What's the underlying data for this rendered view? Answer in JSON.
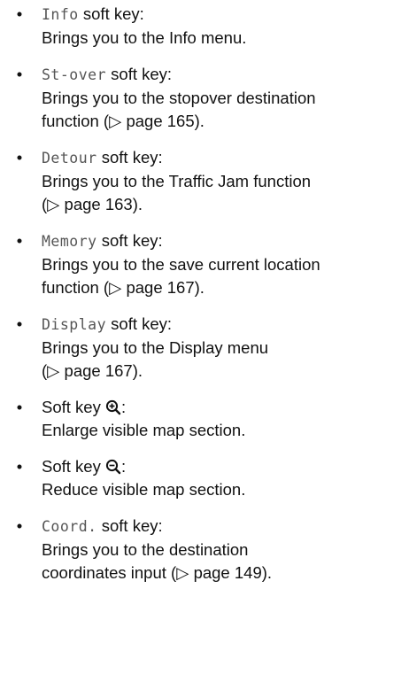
{
  "items": [
    {
      "key": "Info",
      "key_suffix": " soft key:",
      "lines": [
        "Brings you to the Info menu."
      ]
    },
    {
      "key": "St-over",
      "key_suffix": " soft key:",
      "lines": [
        "Brings you to the stopover destination",
        "function (▷ page 165)."
      ]
    },
    {
      "key": "Detour",
      "key_suffix": " soft key:",
      "lines": [
        "Brings you to the Traffic Jam function",
        "(▷ page 163)."
      ]
    },
    {
      "key": "Memory",
      "key_suffix": " soft key:",
      "lines": [
        "Brings you to the save current location",
        "function (▷ page 167)."
      ]
    },
    {
      "key": "Display",
      "key_suffix": " soft key:",
      "lines": [
        "Brings you to the Display menu",
        "(▷ page 167)."
      ]
    },
    {
      "prefix": "Soft key ",
      "icon": "zoom-in-icon",
      "suffix": ":",
      "lines": [
        "Enlarge visible map section."
      ]
    },
    {
      "prefix": "Soft key ",
      "icon": "zoom-out-icon",
      "suffix": ":",
      "lines": [
        "Reduce visible map section."
      ]
    },
    {
      "key": "Coord.",
      "key_suffix": " soft key:",
      "lines": [
        "Brings you to the destination",
        "coordinates input (▷ page 149)."
      ]
    }
  ],
  "bullet_char": "•"
}
